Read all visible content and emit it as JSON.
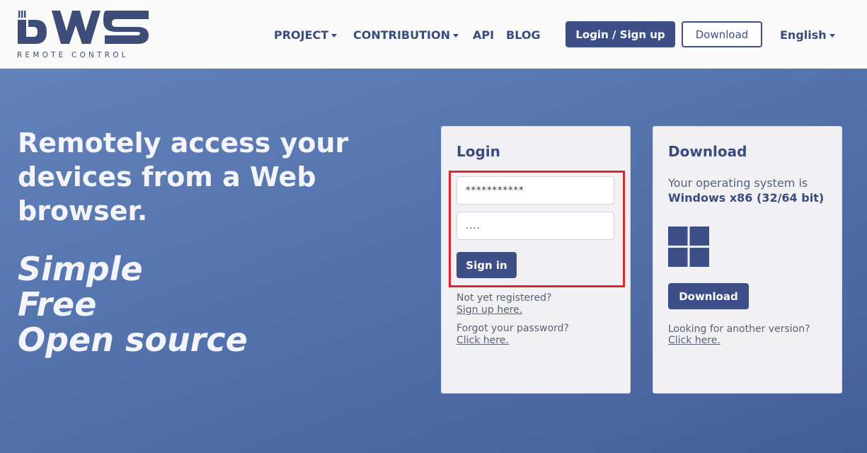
{
  "header": {
    "logo_text": "REMOTE CONTROL",
    "nav": {
      "project": "PROJECT",
      "contribution": "CONTRIBUTION",
      "api": "API",
      "blog": "BLOG"
    },
    "login_signup": "Login / Sign up",
    "download": "Download",
    "language": "English"
  },
  "hero": {
    "headline": "Remotely access your devices from a Web browser.",
    "taglines": [
      "Simple",
      "Free",
      "Open source"
    ]
  },
  "login_card": {
    "title": "Login",
    "username_value": "***********",
    "password_value": "....",
    "signin_label": "Sign in",
    "not_registered": "Not yet registered?",
    "signup_link": "Sign up here.",
    "forgot_password": "Forgot your password?",
    "forgot_link": "Click here."
  },
  "download_card": {
    "title": "Download",
    "os_prefix": "Your operating system is",
    "os_name": "Windows x86 (32/64 bit)",
    "download_label": "Download",
    "other_version": "Looking for another version?",
    "other_link": "Click here."
  },
  "colors": {
    "brand": "#3d4f86",
    "highlight": "#e0262b",
    "hero_gradient_start": "#6382bb",
    "hero_gradient_end": "#465e98"
  },
  "icons": {
    "logo": "dws-logo",
    "windows": "windows-icon",
    "caret": "chevron-down-icon"
  }
}
